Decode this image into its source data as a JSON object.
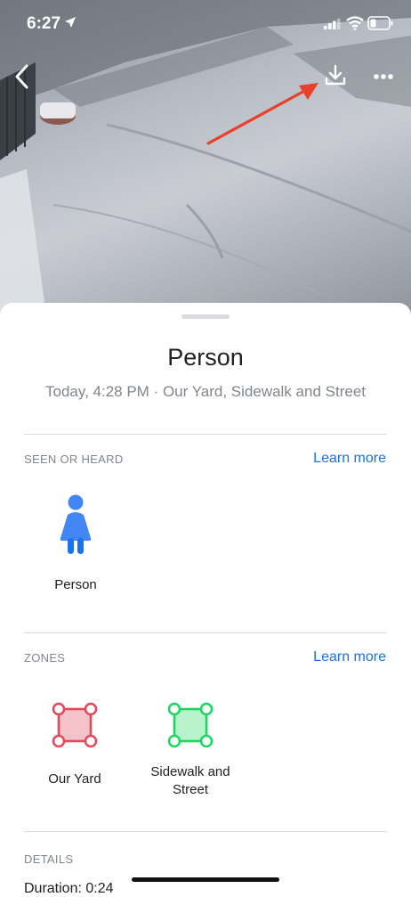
{
  "status_bar": {
    "time": "6:27"
  },
  "event": {
    "title": "Person",
    "subtitle": "Today, 4:28 PM · Our Yard, Sidewalk and Street"
  },
  "seen_or_heard": {
    "label": "SEEN OR HEARD",
    "learn_more": "Learn more",
    "items": [
      {
        "label": "Person",
        "icon": "person-icon",
        "color": "#4285f4"
      }
    ]
  },
  "zones": {
    "label": "ZONES",
    "learn_more": "Learn more",
    "items": [
      {
        "label": "Our Yard",
        "icon": "zone-red-icon",
        "color": "#e2495a"
      },
      {
        "label": "Sidewalk and Street",
        "icon": "zone-green-icon",
        "color": "#1ed760"
      }
    ]
  },
  "details": {
    "label": "DETAILS",
    "duration": "Duration: 0:24"
  },
  "colors": {
    "accent": "#1a73e8",
    "annotation_arrow": "#e8402b"
  }
}
